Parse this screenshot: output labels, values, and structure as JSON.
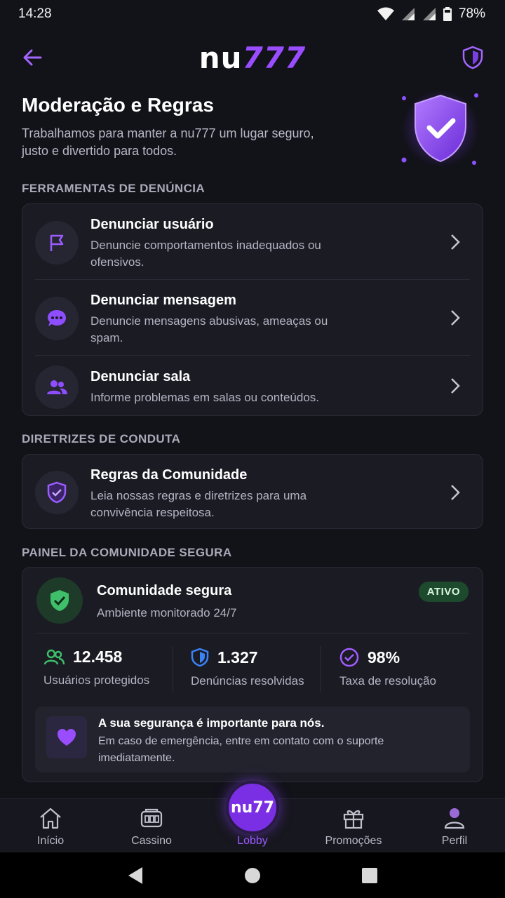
{
  "status_bar": {
    "time": "14:28",
    "battery": "78%"
  },
  "header": {
    "logo_nu": "nu",
    "logo_num": "777"
  },
  "hero": {
    "title": "Moderação e Regras",
    "subtitle": "Trabalhamos para manter a nu777 um lugar seguro, justo e divertido para todos."
  },
  "report_section": {
    "title": "FERRAMENTAS DE DENÚNCIA",
    "items": [
      {
        "title": "Denunciar usuário",
        "desc": "Denuncie comportamentos inadequados ou ofensivos.",
        "icon": "flag-icon"
      },
      {
        "title": "Denunciar mensagem",
        "desc": "Denuncie mensagens abusivas, ameaças ou spam.",
        "icon": "chat-bubble-icon"
      },
      {
        "title": "Denunciar sala",
        "desc": "Informe problemas em salas ou conteúdos.",
        "icon": "group-icon"
      }
    ]
  },
  "conduct_section": {
    "title": "DIRETRIZES DE CONDUTA",
    "items": [
      {
        "title": "Regras da Comunidade",
        "desc": "Leia nossas regras e diretrizes para uma convivência respeitosa.",
        "icon": "shield-check-icon"
      }
    ]
  },
  "safety_panel": {
    "section_title": "PAINEL DA COMUNIDADE SEGURA",
    "title": "Comunidade segura",
    "subtitle": "Ambiente monitorado 24/7",
    "badge": "ATIVO",
    "stats": [
      {
        "value": "12.458",
        "label": "Usuários protegidos",
        "icon": "users-icon",
        "color": "#3fbf6a"
      },
      {
        "value": "1.327",
        "label": "Denúncias resolvidas",
        "icon": "shield-icon",
        "color": "#3b82f6"
      },
      {
        "value": "98%",
        "label": "Taxa de resolução",
        "icon": "check-circle-icon",
        "color": "#a15cff"
      }
    ],
    "notice_title": "A sua segurança é importante para nós.",
    "notice_text": "Em caso de emergência, entre em contato com o suporte imediatamente."
  },
  "bottom_nav": {
    "items": [
      {
        "label": "Início",
        "icon": "home-icon"
      },
      {
        "label": "Cassino",
        "icon": "casino-icon"
      },
      {
        "label": "Lobby",
        "icon": "lobby-logo-icon",
        "active": true
      },
      {
        "label": "Promoções",
        "icon": "gift-icon"
      },
      {
        "label": "Perfil",
        "icon": "profile-icon"
      }
    ],
    "fab_text": "nu77"
  },
  "colors": {
    "accent": "#9a4dff",
    "background": "#121219",
    "card": "#1b1b24",
    "success": "#3fbf6a"
  }
}
